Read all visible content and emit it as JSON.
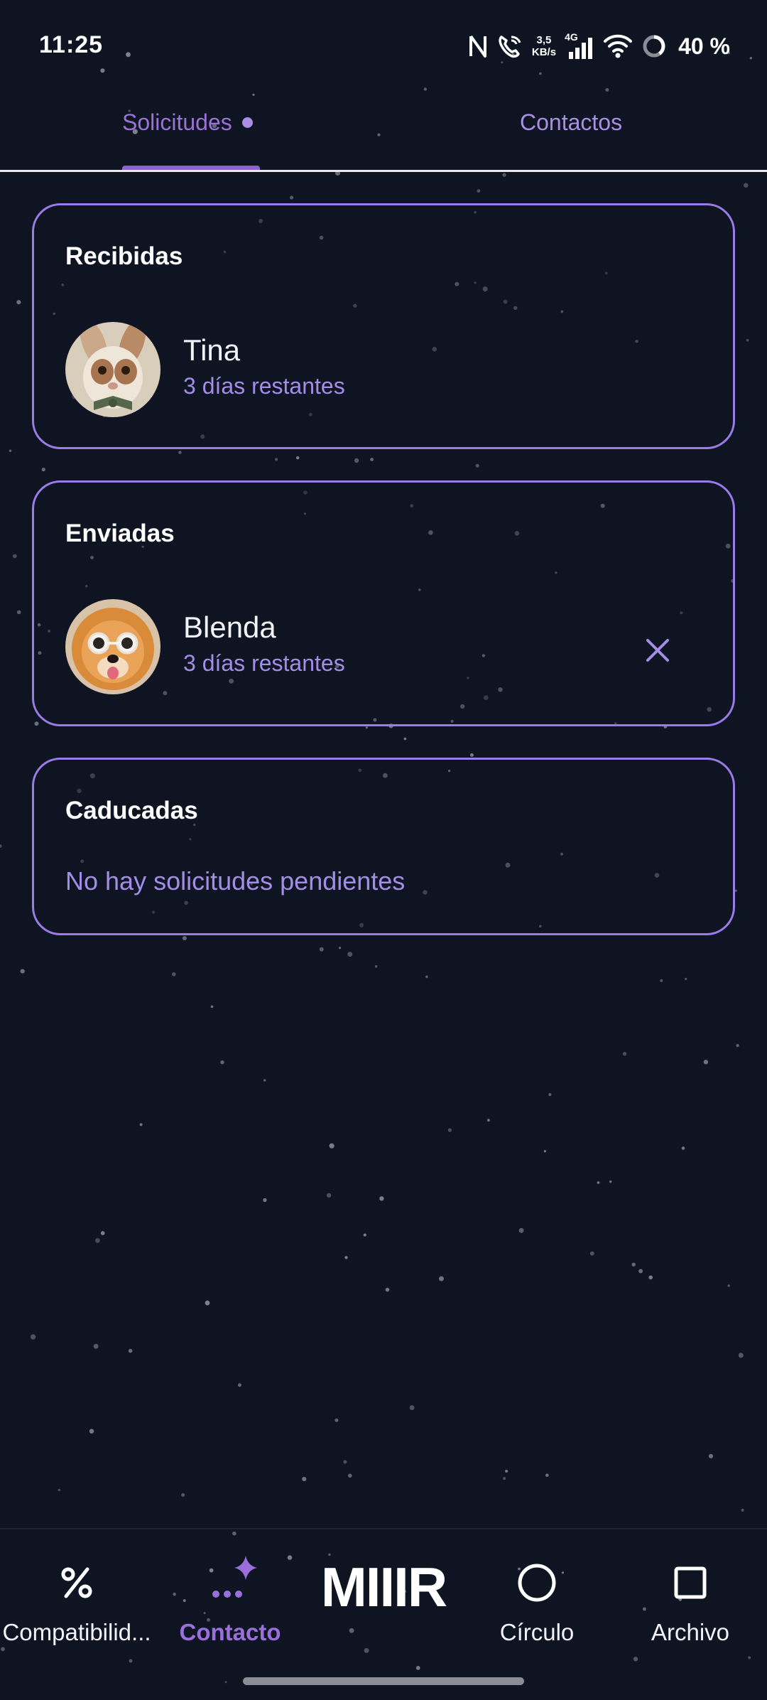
{
  "status_bar": {
    "time": "11:25",
    "net_speed_value": "3,5",
    "net_speed_unit": "KB/s",
    "network_type": "4G",
    "battery": "40 %",
    "icons": [
      "nfc-icon",
      "wifi-calling-icon",
      "signal-icon",
      "wifi-icon",
      "battery-ring-icon"
    ]
  },
  "tabs": {
    "solicitudes": "Solicitudes",
    "contactos": "Contactos",
    "active": "Solicitudes",
    "solicitudes_has_dot": true
  },
  "sections": {
    "received": {
      "title": "Recibidas",
      "items": [
        {
          "name": "Tina",
          "subtitle": "3 días restantes",
          "avatar": "rabbit-avatar"
        }
      ]
    },
    "sent": {
      "title": "Enviadas",
      "items": [
        {
          "name": "Blenda",
          "subtitle": "3 días restantes",
          "avatar": "pomeranian-avatar",
          "action": "close-icon"
        }
      ]
    },
    "expired": {
      "title": "Caducadas",
      "empty_text": "No hay solicitudes pendientes"
    }
  },
  "bottom_nav": {
    "items": [
      {
        "label": "Compatibilid...",
        "icon": "percent-icon"
      },
      {
        "label": "Contacto",
        "icon": "dots-sparkle-icon",
        "active": true
      },
      {
        "label": "MIIIR",
        "icon": "logo"
      },
      {
        "label": "Círculo",
        "icon": "circle-icon"
      },
      {
        "label": "Archivo",
        "icon": "square-icon"
      }
    ]
  },
  "colors": {
    "background": "#0e1422",
    "accent": "#9a7be8",
    "accent_text": "#a48de6",
    "active_tab": "#9a72d6"
  }
}
